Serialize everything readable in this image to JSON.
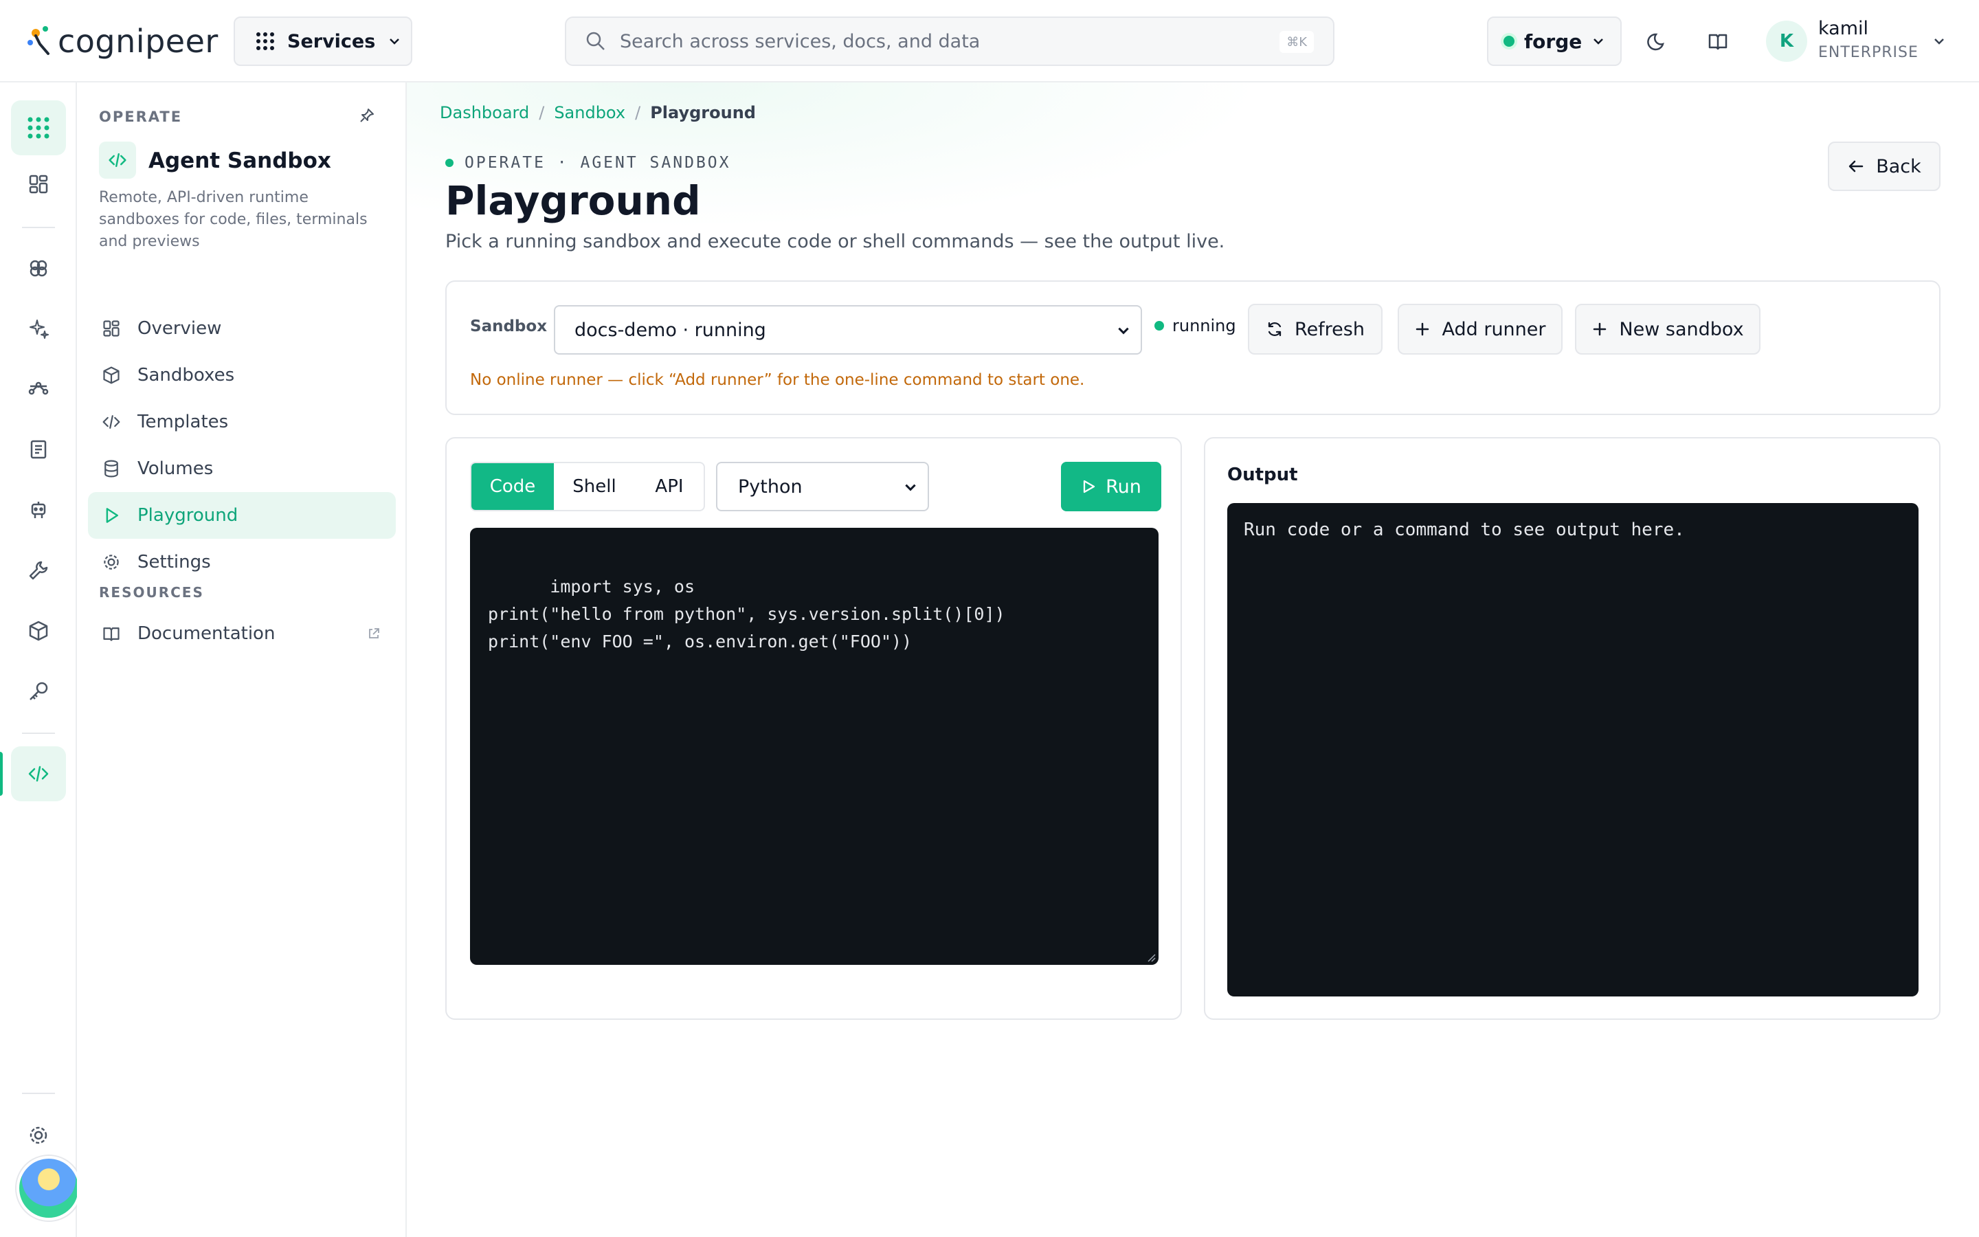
{
  "header": {
    "brand": "cognipeer",
    "services_label": "Services",
    "search_placeholder": "Search across services, docs, and data",
    "search_shortcut": "⌘K",
    "environment": "forge",
    "user_initial": "K",
    "user_name": "kamil",
    "user_plan": "ENTERPRISE"
  },
  "rail": {
    "items": [
      "apps-icon",
      "dashboard-icon",
      "brain-icon",
      "sparkles-icon",
      "route-icon",
      "document-icon",
      "robot-icon",
      "tools-icon",
      "cube-icon",
      "key-icon",
      "code-icon",
      "settings-icon"
    ],
    "active": "code-icon"
  },
  "sidebar": {
    "section": "OPERATE",
    "title": "Agent Sandbox",
    "description": "Remote, API-driven runtime sandboxes for code, files, terminals and previews",
    "nav": [
      {
        "label": "Overview",
        "icon": "dashboard-icon"
      },
      {
        "label": "Sandboxes",
        "icon": "cube-icon"
      },
      {
        "label": "Templates",
        "icon": "code-icon"
      },
      {
        "label": "Volumes",
        "icon": "database-icon"
      },
      {
        "label": "Playground",
        "icon": "play-icon",
        "active": true
      },
      {
        "label": "Settings",
        "icon": "gear-icon"
      }
    ],
    "resources_section": "RESOURCES",
    "resources": [
      {
        "label": "Documentation",
        "icon": "book-icon",
        "external": true
      }
    ]
  },
  "breadcrumb": [
    "Dashboard",
    "Sandbox",
    "Playground"
  ],
  "page": {
    "eyebrow": "OPERATE · AGENT SANDBOX",
    "title": "Playground",
    "subtitle": "Pick a running sandbox and execute code or shell commands — see the output live.",
    "back_label": "Back"
  },
  "sandbox_bar": {
    "label": "Sandbox",
    "selected": "docs-demo · running",
    "status": "running",
    "refresh_label": "Refresh",
    "add_runner_label": "Add runner",
    "new_sandbox_label": "New sandbox",
    "warning": "No online runner — click “Add runner” for the one-line command to start one."
  },
  "editor": {
    "tabs": [
      "Code",
      "Shell",
      "API"
    ],
    "active_tab": "Code",
    "language": "Python",
    "run_label": "Run",
    "code": "import sys, os\nprint(\"hello from python\", sys.version.split()[0])\nprint(\"env FOO =\", os.environ.get(\"FOO\"))"
  },
  "output": {
    "title": "Output",
    "placeholder": "Run code or a command to see output here."
  },
  "colors": {
    "accent": "#12b886",
    "accent_text": "#0ea57a",
    "warning": "#c2680a",
    "terminal_bg": "#0f1419"
  }
}
